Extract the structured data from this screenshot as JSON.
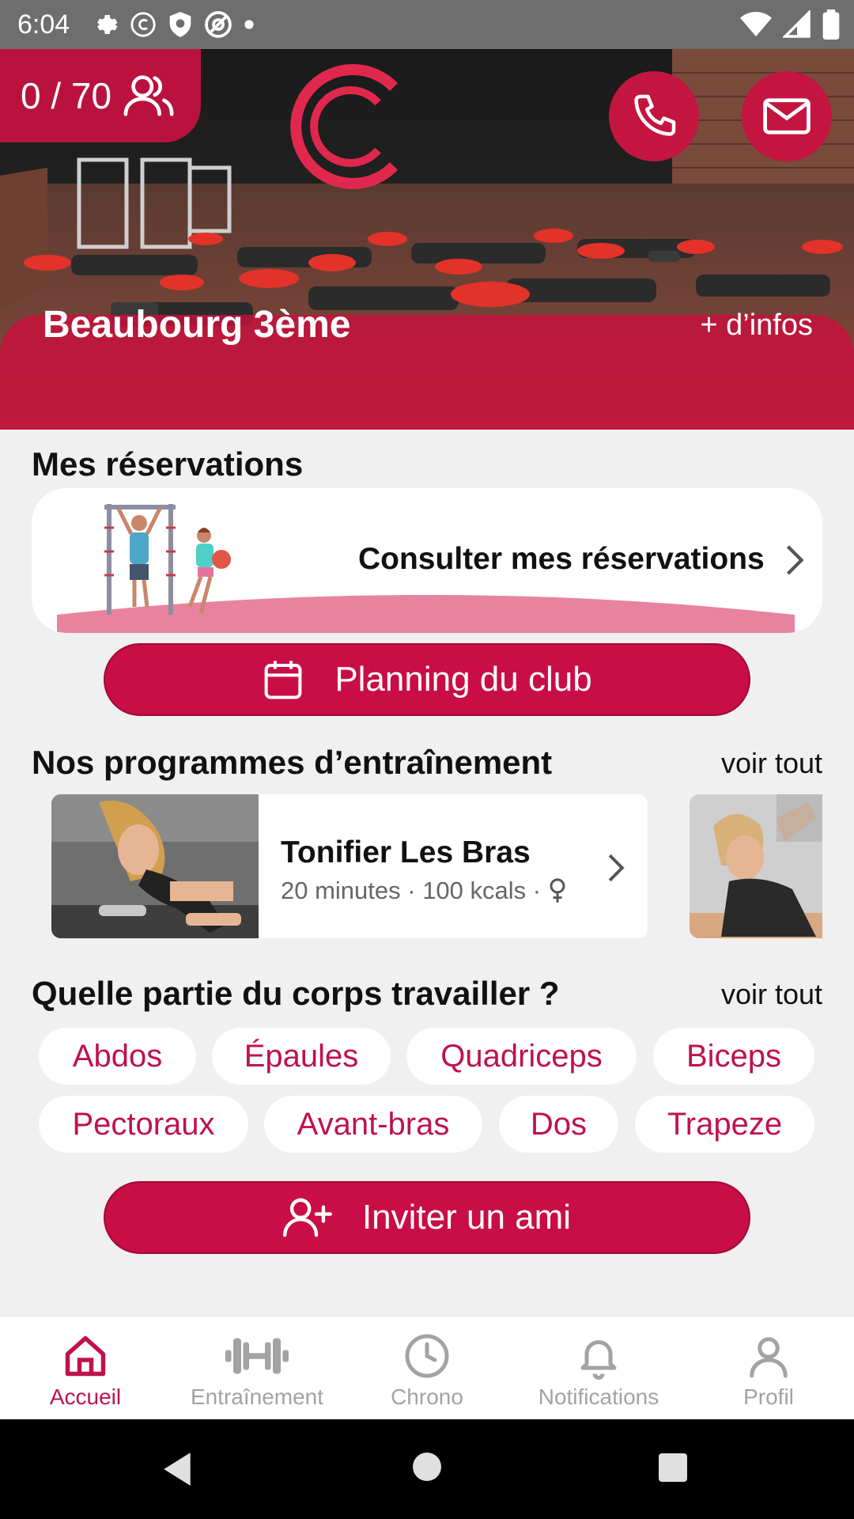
{
  "status_bar": {
    "time": "6:04"
  },
  "hero": {
    "counter_text": "0 / 70",
    "club_name": "Beaubourg 3ème",
    "more_info": "+ d’infos"
  },
  "reservations": {
    "title": "Mes réservations",
    "card_label": "Consulter mes réservations"
  },
  "planning_button": "Planning du club",
  "programs": {
    "title": "Nos programmes d’entraînement",
    "see_all": "voir tout",
    "items": [
      {
        "title": "Tonifier Les Bras",
        "meta": "20 minutes · 100 kcals ·"
      }
    ]
  },
  "body_parts": {
    "title": "Quelle partie du corps travailler ?",
    "see_all": "voir tout",
    "chips": [
      "Abdos",
      "Épaules",
      "Quadriceps",
      "Biceps",
      "Pectoraux",
      "Avant-bras",
      "Dos",
      "Trapeze"
    ]
  },
  "invite_button": "Inviter un ami",
  "bottom_nav": {
    "items": [
      {
        "label": "Accueil",
        "icon": "home-icon",
        "active": true
      },
      {
        "label": "Entraînement",
        "icon": "dumbbell-icon",
        "active": false
      },
      {
        "label": "Chrono",
        "icon": "clock-icon",
        "active": false
      },
      {
        "label": "Notifications",
        "icon": "bell-icon",
        "active": false
      },
      {
        "label": "Profil",
        "icon": "profile-icon",
        "active": false
      }
    ]
  },
  "colors": {
    "accent": "#c90d46",
    "status_bar": "#6e6e6e",
    "background": "#f1f0f0"
  }
}
